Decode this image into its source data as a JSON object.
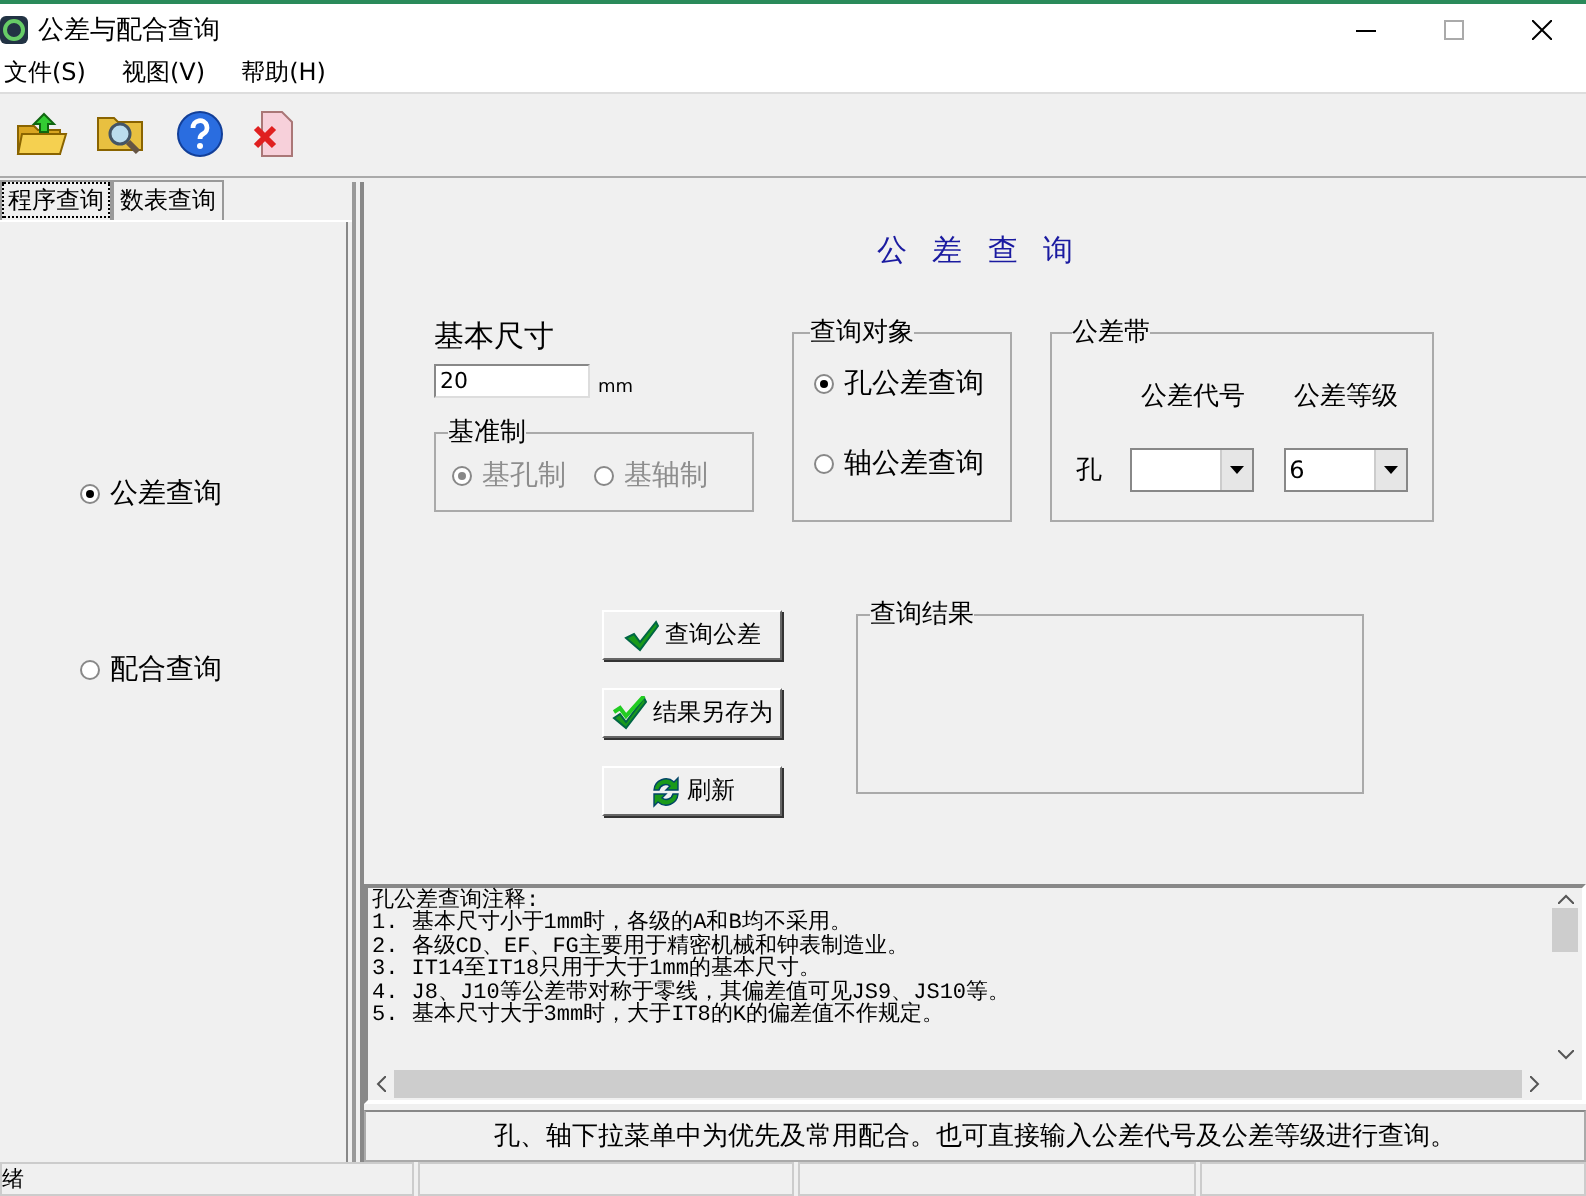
{
  "window": {
    "title": "公差与配合查询"
  },
  "menu": [
    "文件(S)",
    "视图(V)",
    "帮助(H)"
  ],
  "tabs": [
    {
      "label": "程序查询",
      "selected": true
    },
    {
      "label": "数表查询",
      "selected": false
    }
  ],
  "modes": [
    {
      "label": "公差查询",
      "selected": true
    },
    {
      "label": "配合查询",
      "selected": false
    }
  ],
  "form": {
    "title": "公 差 查 询",
    "basic_size": {
      "label": "基本尺寸",
      "value": "20",
      "unit": "mm"
    },
    "base_system": {
      "title": "基准制",
      "disabled": true,
      "options": [
        {
          "label": "基孔制",
          "selected": true
        },
        {
          "label": "基轴制",
          "selected": false
        }
      ]
    },
    "query_object": {
      "title": "查询对象",
      "options": [
        {
          "label": "孔公差查询",
          "selected": true
        },
        {
          "label": "轴公差查询",
          "selected": false
        }
      ]
    },
    "tolerance_zone": {
      "title": "公差带",
      "row_label": "孔",
      "code_label": "公差代号",
      "grade_label": "公差等级",
      "grade_value": "6"
    },
    "buttons": [
      {
        "label": "查询公差",
        "kind": "check"
      },
      {
        "label": "结果另存为",
        "kind": "double-check"
      },
      {
        "label": "刷新",
        "kind": "refresh"
      }
    ],
    "result": {
      "title": "查询结果"
    }
  },
  "notes": [
    "孔公差查询注释:",
    "1. 基本尺寸小于1mm时，各级的A和B均不采用。",
    "2. 各级CD、EF、FG主要用于精密机械和钟表制造业。",
    "3. IT14至IT18只用于大于1mm的基本尺寸。",
    "4. J8、J10等公差带对称于零线，其偏差值可见JS9、JS10等。",
    "5. 基本尺寸大于3mm时，大于IT8的K的偏差值不作规定。"
  ],
  "hint": "孔、轴下拉菜单中为优先及常用配合。也可直接输入公差代号及公差等级进行查询。",
  "status_bar": [
    "绪"
  ]
}
